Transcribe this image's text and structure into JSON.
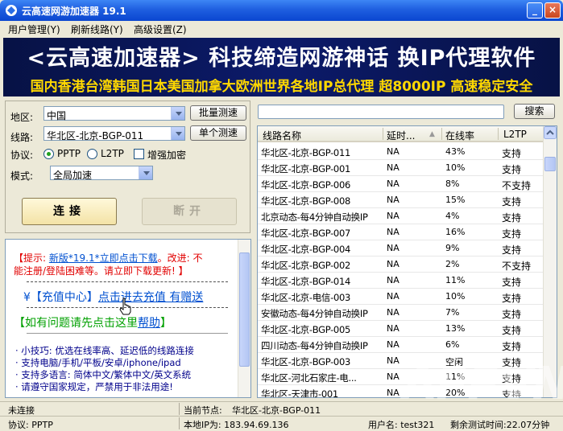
{
  "window": {
    "title": "云高速网游加速器 19.1",
    "minimize": "_",
    "close": "×"
  },
  "menu": [
    "用户管理(Y)",
    "刷新线路(Y)",
    "高级设置(Z)"
  ],
  "banner": {
    "line1": "<云高速加速器> 科技缔造网游神话 换IP代理软件",
    "line2": "国内香港台湾韩国日本美国加拿大欧洲世界各地IP总代理 超8000IP 高速稳定安全"
  },
  "settings": {
    "region_label": "地区:",
    "region_value": "中国",
    "line_label": "线路:",
    "line_value": "华北区-北京-BGP-011",
    "protocol_label": "协议:",
    "protocol_pptp": "PPTP",
    "protocol_l2tp": "L2TP",
    "encrypt_label": "增强加密",
    "mode_label": "模式:",
    "mode_value": "全局加速",
    "batch_test": "批量测速",
    "single_test": "单个测速",
    "connect": "连接",
    "disconnect": "断开"
  },
  "notice": {
    "tip1": "【提示: ",
    "tip1_link": "新版*19.1*立即点击下载",
    "tip1_rest": "。改进: 不",
    "tip2": "能注册/登陆困难等。请立即下载更新! 】",
    "recharge_prefix": "¥【充值中心】",
    "recharge_link": "点击进去充值 有赠送",
    "help_prefix": "【如有问题请先点击这里",
    "help_link": "帮助",
    "help_suffix": "】",
    "tips": [
      "· 小技巧: 优选在线率高、延迟低的线路连接",
      "· 支持电脑/手机/平板/安卓/iphone/ipad",
      "· 支持多语言: 简体中文/繁体中文/英文系统",
      "· 请遵守国家规定，严禁用于非法用途!"
    ]
  },
  "search": {
    "button": "搜索",
    "value": ""
  },
  "table": {
    "headers": [
      "线路名称",
      "延时...",
      "在线率",
      "L2TP"
    ],
    "rows": [
      [
        "华北区-北京-BGP-011",
        "NA",
        "43%",
        "支持"
      ],
      [
        "华北区-北京-BGP-001",
        "NA",
        "10%",
        "支持"
      ],
      [
        "华北区-北京-BGP-006",
        "NA",
        "8%",
        "不支持"
      ],
      [
        "华北区-北京-BGP-008",
        "NA",
        "15%",
        "支持"
      ],
      [
        "北京动态-每4分钟自动换IP",
        "NA",
        "4%",
        "支持"
      ],
      [
        "华北区-北京-BGP-007",
        "NA",
        "16%",
        "支持"
      ],
      [
        "华北区-北京-BGP-004",
        "NA",
        "9%",
        "支持"
      ],
      [
        "华北区-北京-BGP-002",
        "NA",
        "2%",
        "不支持"
      ],
      [
        "华北区-北京-BGP-014",
        "NA",
        "11%",
        "支持"
      ],
      [
        "华北区-北京-电信-003",
        "NA",
        "10%",
        "支持"
      ],
      [
        "安徽动态-每4分钟自动换IP",
        "NA",
        "7%",
        "支持"
      ],
      [
        "华北区-北京-BGP-005",
        "NA",
        "13%",
        "支持"
      ],
      [
        "四川动态-每4分钟自动换IP",
        "NA",
        "6%",
        "支持"
      ],
      [
        "华北区-北京-BGP-003",
        "NA",
        "空闲",
        "支持"
      ],
      [
        "华北区-河北石家庄-电...",
        "NA",
        "11%",
        "支持"
      ],
      [
        "华北区-天津市-001",
        "NA",
        "20%",
        "支持"
      ]
    ]
  },
  "status": {
    "conn_state": "未连接",
    "current_node_label": "当前节点:",
    "current_node": "华北区-北京-BGP-011",
    "protocol": "协议: PPTP",
    "local_ip": "本地IP为: 183.94.69.136",
    "username": "用户名: test321",
    "remaining": "剩余测试时间:22.07分钟"
  },
  "watermark": "APPVN"
}
